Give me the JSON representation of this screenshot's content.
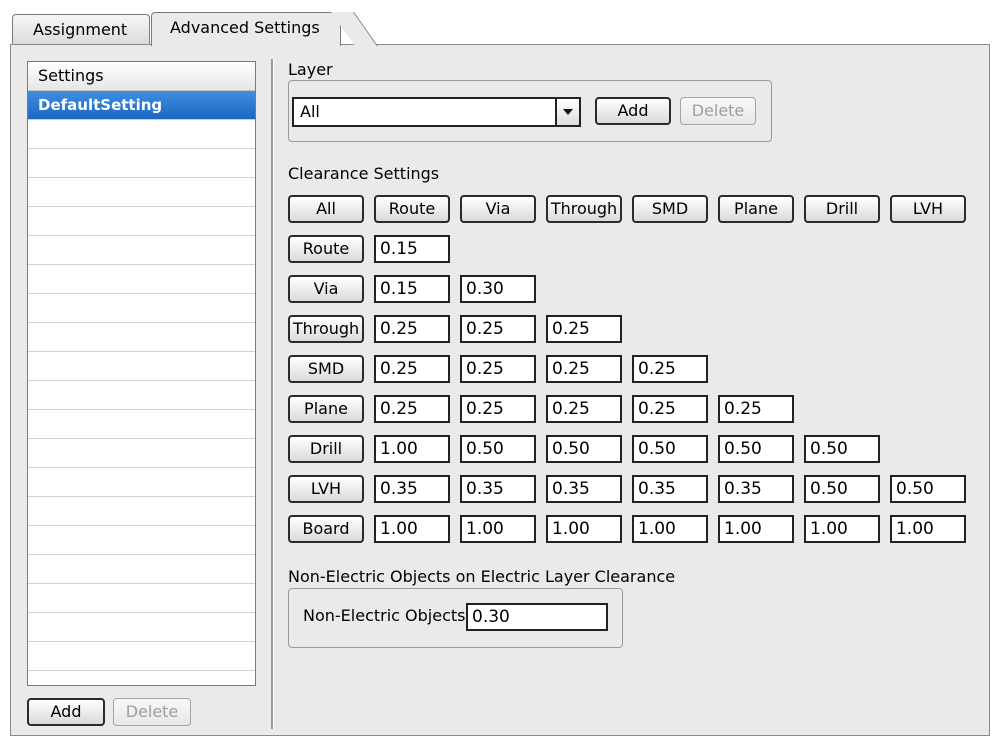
{
  "tabs": [
    {
      "label": "Assignment"
    },
    {
      "label": "Advanced Settings"
    }
  ],
  "settings_list": {
    "header": "Settings",
    "items": [
      "DefaultSetting"
    ],
    "add_label": "Add",
    "delete_label": "Delete"
  },
  "layer": {
    "title": "Layer",
    "selected": "All",
    "add_label": "Add",
    "delete_label": "Delete"
  },
  "clearance": {
    "title": "Clearance Settings",
    "all_label": "All",
    "columns": [
      "Route",
      "Via",
      "Through",
      "SMD",
      "Plane",
      "Drill",
      "LVH"
    ],
    "rows": [
      {
        "label": "Route",
        "values": [
          "0.15"
        ]
      },
      {
        "label": "Via",
        "values": [
          "0.15",
          "0.30"
        ]
      },
      {
        "label": "Through",
        "values": [
          "0.25",
          "0.25",
          "0.25"
        ]
      },
      {
        "label": "SMD",
        "values": [
          "0.25",
          "0.25",
          "0.25",
          "0.25"
        ]
      },
      {
        "label": "Plane",
        "values": [
          "0.25",
          "0.25",
          "0.25",
          "0.25",
          "0.25"
        ]
      },
      {
        "label": "Drill",
        "values": [
          "1.00",
          "0.50",
          "0.50",
          "0.50",
          "0.50",
          "0.50"
        ]
      },
      {
        "label": "LVH",
        "values": [
          "0.35",
          "0.35",
          "0.35",
          "0.35",
          "0.35",
          "0.50",
          "0.50"
        ]
      },
      {
        "label": "Board",
        "values": [
          "1.00",
          "1.00",
          "1.00",
          "1.00",
          "1.00",
          "1.00",
          "1.00"
        ]
      }
    ]
  },
  "non_electric": {
    "title": "Non-Electric Objects on Electric Layer Clearance",
    "label": "Non-Electric Objects",
    "value": "0.30"
  }
}
